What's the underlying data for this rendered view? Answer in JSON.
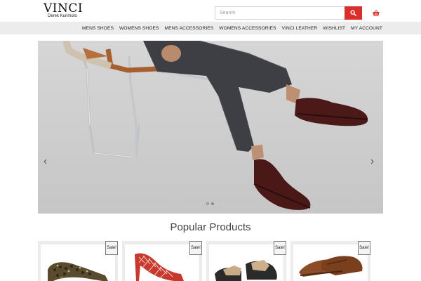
{
  "brand": {
    "name": "VINCI",
    "subtitle": "Derek Kurimoto"
  },
  "search": {
    "placeholder": "Search"
  },
  "icons": {
    "search": "search-icon",
    "cart": "shopping-basket-icon",
    "prev": "chevron-left-icon",
    "next": "chevron-right-icon"
  },
  "nav": {
    "items": [
      {
        "label": "MENS SHOES"
      },
      {
        "label": "WOMENS SHOES"
      },
      {
        "label": "MENS ACCESSORIES"
      },
      {
        "label": "WOMENS ACCESSORIES"
      },
      {
        "label": "VINCI LEATHER"
      },
      {
        "label": "WISHLIST"
      },
      {
        "label": "MY ACCOUNT"
      }
    ]
  },
  "slider": {
    "slide_count": 2,
    "active_slide": 2
  },
  "popular": {
    "title": "Popular Products",
    "products": [
      {
        "badge": "Sale!"
      },
      {
        "badge": "Sale!"
      },
      {
        "badge": "Sale!"
      },
      {
        "badge": "Sale!"
      }
    ]
  },
  "colors": {
    "accent": "#d9302b",
    "nav_bg": "#ececec"
  }
}
